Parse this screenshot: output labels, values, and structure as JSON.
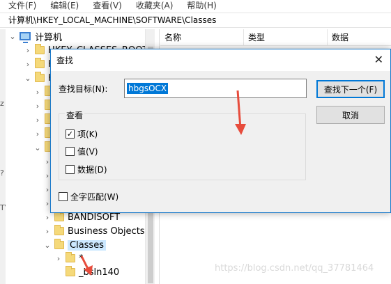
{
  "menubar": {
    "items": [
      "文件(F)",
      "编辑(E)",
      "查看(V)",
      "收藏夹(A)",
      "帮助(H)"
    ]
  },
  "address": {
    "path": "计算机\\HKEY_LOCAL_MACHINE\\SOFTWARE\\Classes"
  },
  "tree": {
    "root": "计算机",
    "partial_row": "HKEY_CLASSES_ROOT",
    "row_h1": "H",
    "row_h2": "H",
    "bandisoft": "BANDISOFT",
    "business": "Business Objects",
    "classes": "Classes",
    "star": "*",
    "bsln": "_bsln140"
  },
  "list": {
    "columns": [
      "名称",
      "类型",
      "数据"
    ]
  },
  "dialog": {
    "title": "查找",
    "find_label": "查找目标(N):",
    "find_value": "hbgsOCX",
    "find_next_button": "查找下一个(F)",
    "cancel_button": "取消",
    "look_at_label": "查看",
    "option_keys": "项(K)",
    "option_keys_checked": true,
    "option_values": "值(V)",
    "option_values_checked": false,
    "option_data": "数据(D)",
    "option_data_checked": false,
    "match_whole": "全字匹配(W)",
    "match_whole_checked": false,
    "check_mark": "✓"
  },
  "leftstrip": {
    "marks": [
      "z",
      "?",
      "TV"
    ]
  },
  "watermark": "https://blog.csdn.net/qq_37781464",
  "colors": {
    "accent": "#0078d7",
    "dialog_border": "#1979ca",
    "arrow": "#e74c3c"
  }
}
